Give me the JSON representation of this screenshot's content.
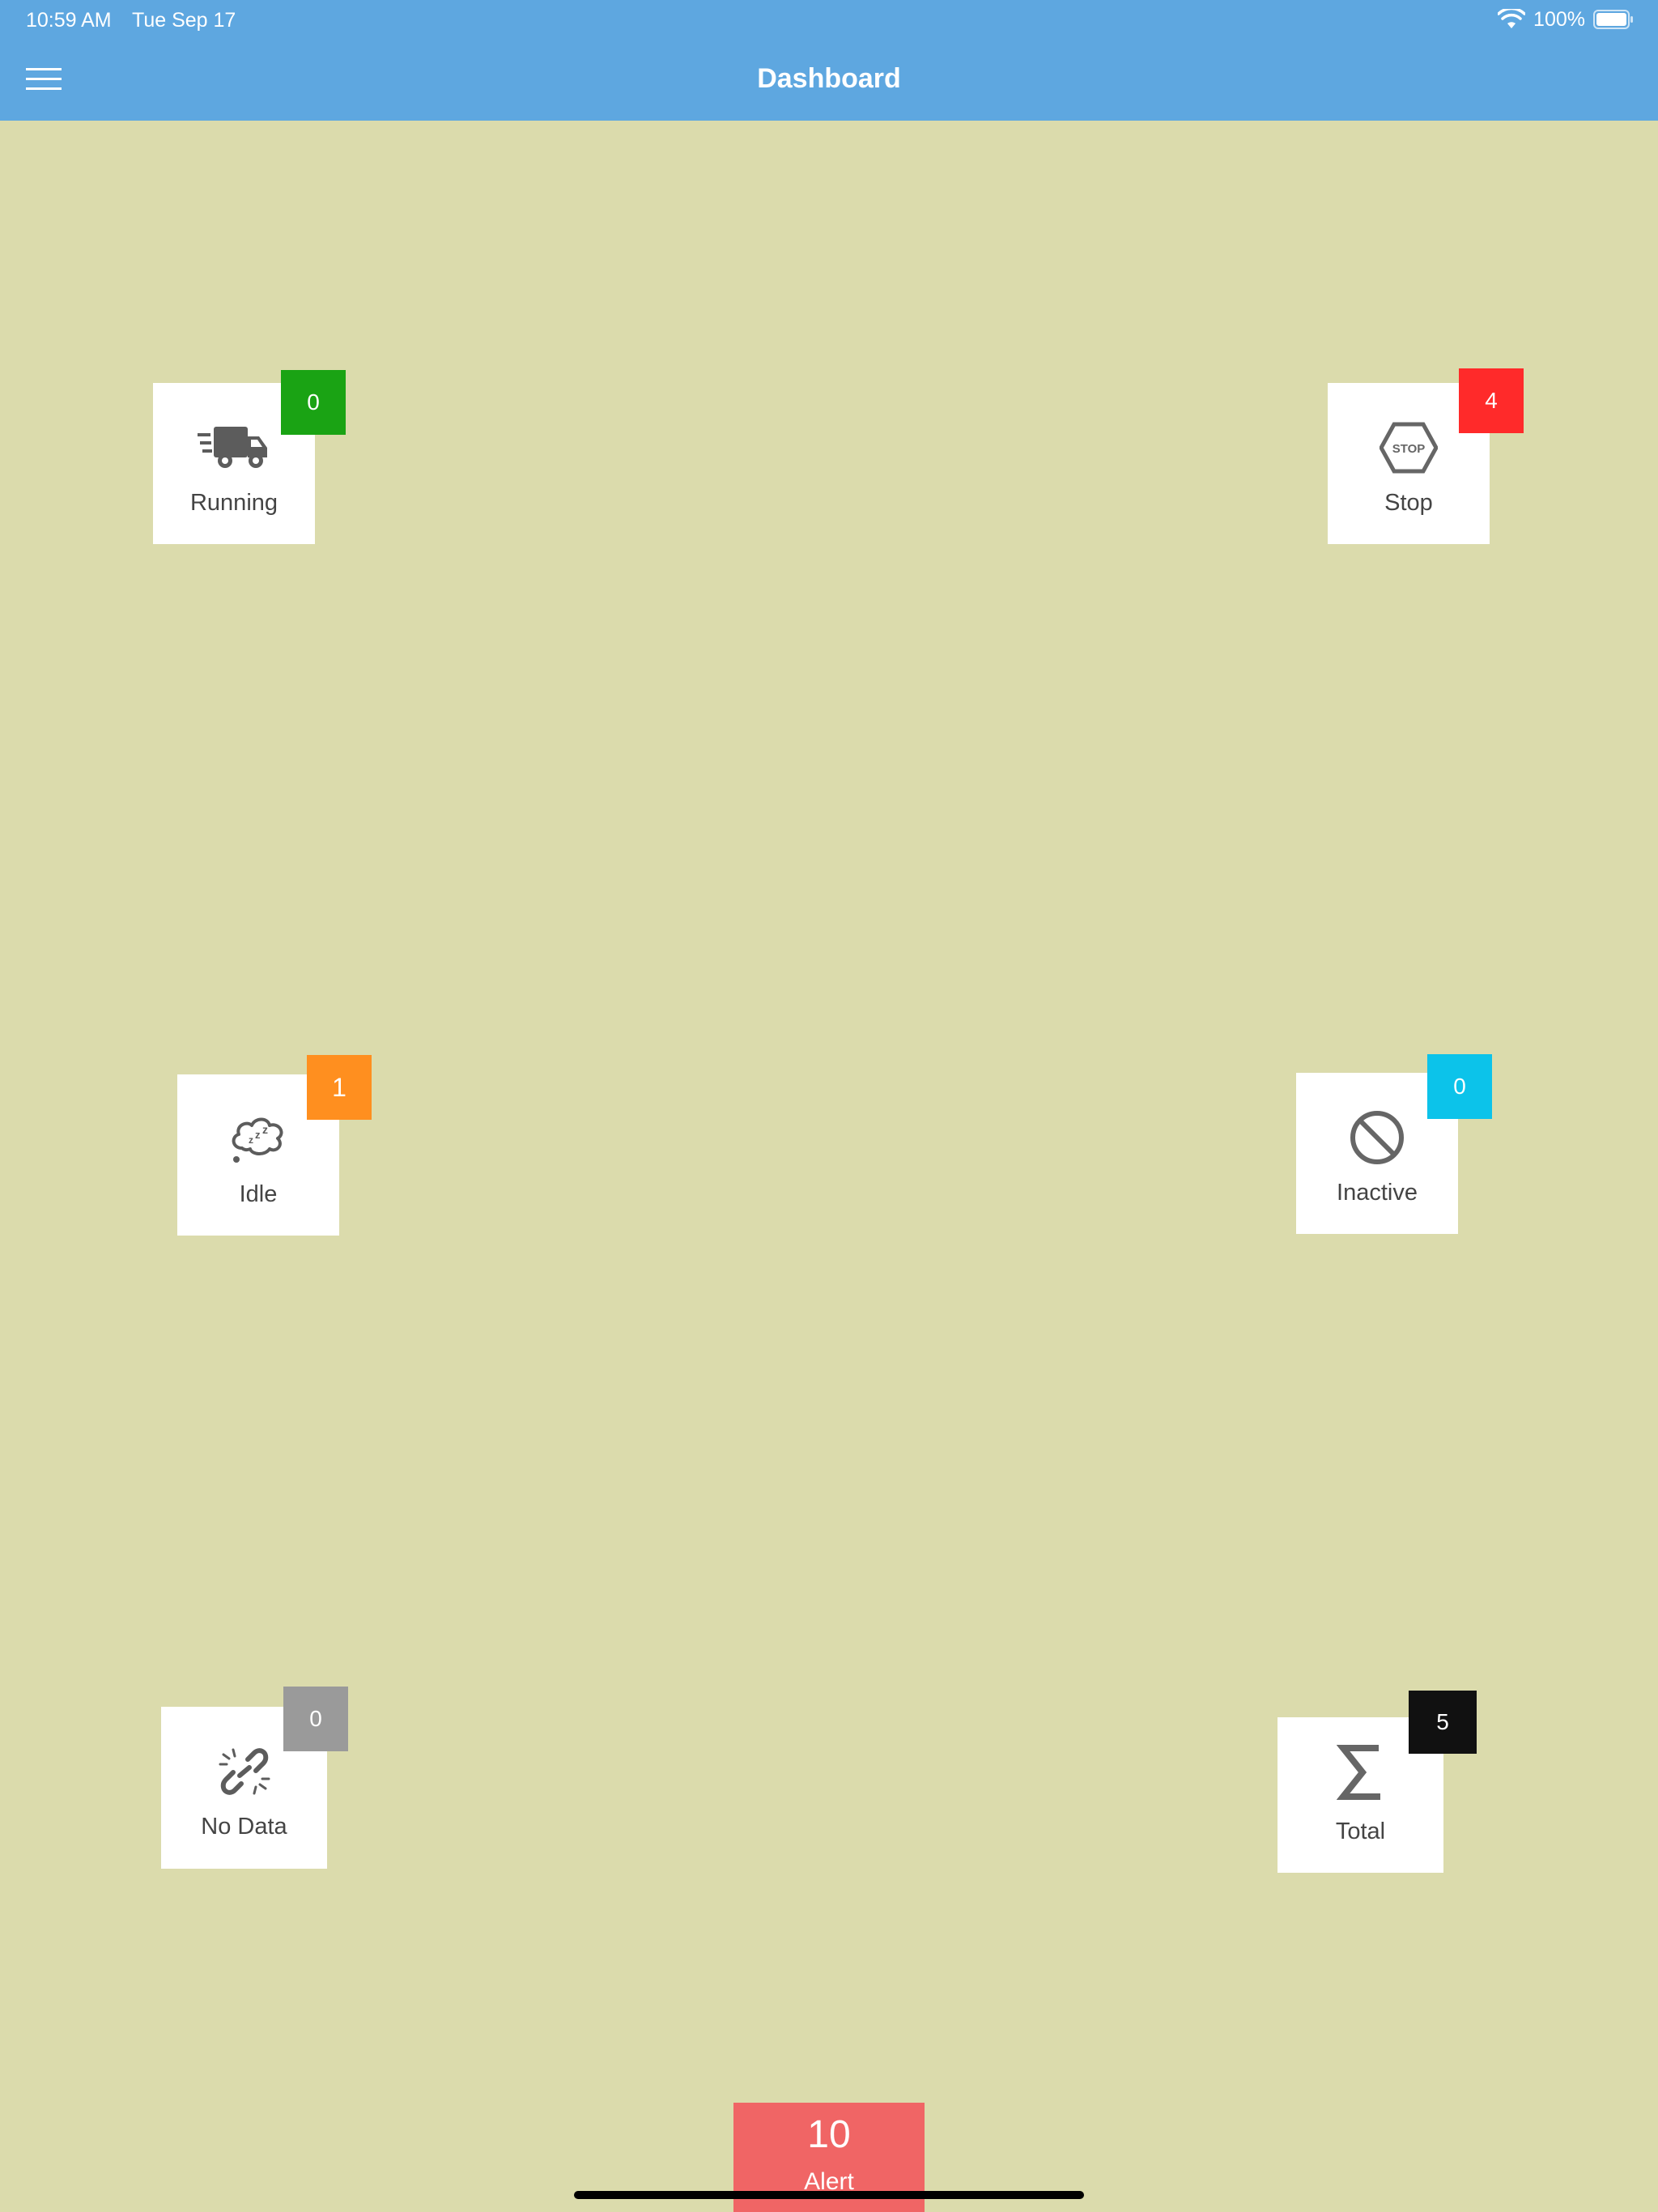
{
  "status_bar": {
    "time": "10:59 AM",
    "date": "Tue Sep 17",
    "battery": "100%"
  },
  "header": {
    "title": "Dashboard",
    "background_color": "#5ea7e0",
    "menu_icon": "hamburger-menu-icon"
  },
  "background_color": "#dbdbac",
  "tiles": [
    {
      "label": "Running",
      "count": "0",
      "badge_color": "#1aa314",
      "icon": "truck-icon"
    },
    {
      "label": "Stop",
      "count": "4",
      "badge_color": "#ff2a2a",
      "icon": "stop-sign-icon"
    },
    {
      "label": "Idle",
      "count": "1",
      "badge_color": "#ff8f1f",
      "icon": "sleep-cloud-icon"
    },
    {
      "label": "Inactive",
      "count": "0",
      "badge_color": "#0cc3ea",
      "icon": "prohibited-icon"
    },
    {
      "label": "No Data",
      "count": "0",
      "badge_color": "#9a9a9a",
      "icon": "broken-link-icon"
    },
    {
      "label": "Total",
      "count": "5",
      "badge_color": "#111111",
      "icon": "sigma-icon"
    }
  ],
  "alert": {
    "count": "10",
    "label": "Alert",
    "color": "#f06565"
  }
}
